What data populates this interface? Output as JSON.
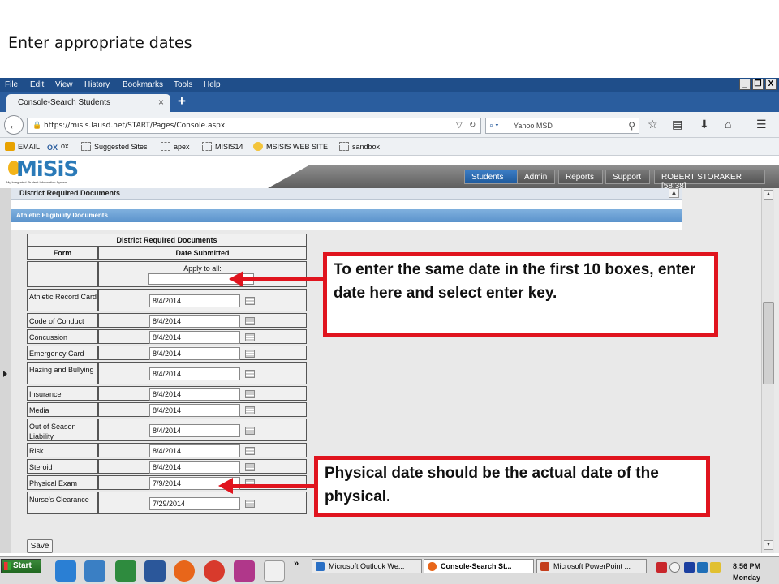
{
  "slide": {
    "title": "Enter appropriate dates"
  },
  "browser": {
    "menu": [
      "File",
      "Edit",
      "View",
      "History",
      "Bookmarks",
      "Tools",
      "Help"
    ],
    "window_controls": [
      "_",
      "❐",
      "X"
    ],
    "tab": {
      "label": "Console-Search Students",
      "close": "×",
      "new_tab": "+"
    },
    "url": "https://misis.lausd.net/START/Pages/Console.aspx",
    "search": {
      "engine": "⌕ ▾",
      "value": "Yahoo MSD"
    },
    "bookmarks": [
      "EMAIL",
      "ox",
      "Suggested Sites",
      "apex",
      "MISIS14",
      "MSISIS WEB SITE",
      "sandbox"
    ]
  },
  "app": {
    "logo_text": "MiSiS",
    "logo_subtitle": "My Integrated Student Information System",
    "nav": [
      "Students",
      "Admin",
      "Reports",
      "Support",
      "ROBERT STORAKER [58:38]"
    ],
    "panel_title": "District Required Documents",
    "section_title": "Athletic Eligibility Documents",
    "table": {
      "caption": "District Required Documents",
      "col_form": "Form",
      "col_date": "Date Submitted",
      "apply_all_label": "Apply to all:",
      "apply_all_value": "",
      "rows": [
        {
          "form": "Athletic Record Card",
          "date": "8/4/2014"
        },
        {
          "form": "Code of Conduct",
          "date": "8/4/2014"
        },
        {
          "form": "Concussion",
          "date": "8/4/2014"
        },
        {
          "form": "Emergency Card",
          "date": "8/4/2014"
        },
        {
          "form": "Hazing and Bullying",
          "date": "8/4/2014"
        },
        {
          "form": "Insurance",
          "date": "8/4/2014"
        },
        {
          "form": "Media",
          "date": "8/4/2014"
        },
        {
          "form": "Out of Season Liability",
          "date": "8/4/2014"
        },
        {
          "form": "Risk",
          "date": "8/4/2014"
        },
        {
          "form": "Steroid",
          "date": "8/4/2014"
        },
        {
          "form": "Physical Exam",
          "date": "7/9/2014"
        },
        {
          "form": "Nurse's Clearance",
          "date": "7/29/2014"
        }
      ]
    },
    "save_label": "Save"
  },
  "callouts": {
    "apply_all": "To enter the same date in the first 10 boxes, enter date here and select enter key.",
    "physical": "Physical date should be the actual date of the physical."
  },
  "taskbar": {
    "start": "Start",
    "overflow": "»",
    "tasks": [
      "Microsoft Outlook We...",
      "Console-Search St...",
      "Microsoft PowerPoint ..."
    ],
    "time": "8:56 PM",
    "day": "Monday"
  },
  "colors": {
    "accent": "#e0141e",
    "menubar": "#1f4e8a",
    "section": "#5b93cc"
  }
}
